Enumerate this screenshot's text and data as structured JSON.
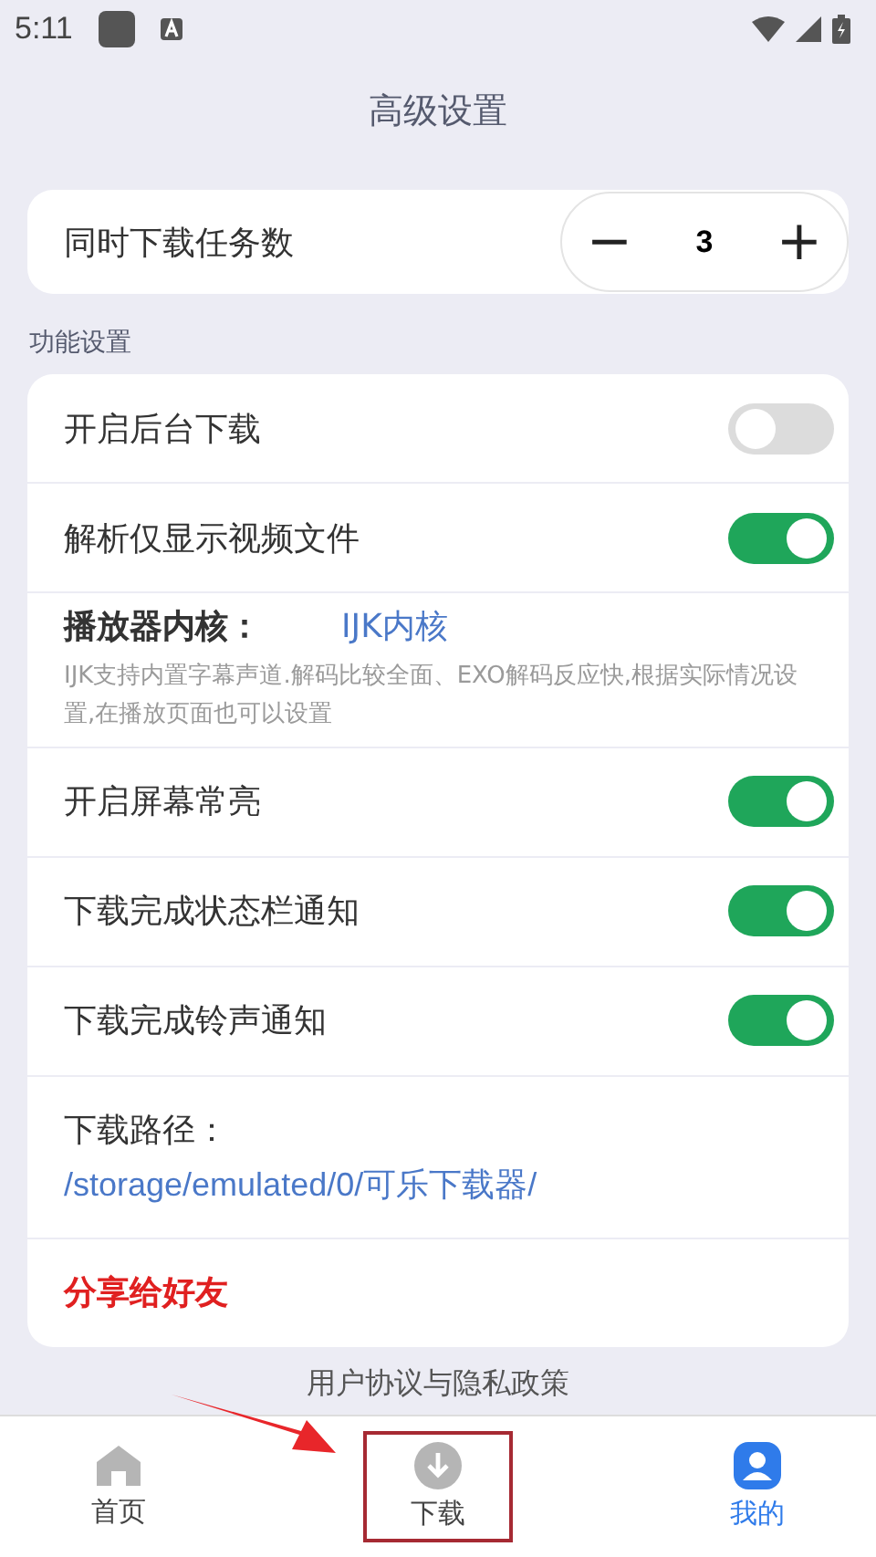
{
  "status_bar": {
    "time": "5:11"
  },
  "title": "高级设置",
  "concurrent": {
    "label": "同时下载任务数",
    "minus": "−",
    "value": "3",
    "plus": "+"
  },
  "section_title": "功能设置",
  "settings": [
    {
      "kind": "toggle",
      "label": "开启后台下载",
      "on": false
    },
    {
      "kind": "toggle",
      "label": "解析仅显示视频文件",
      "on": true
    },
    {
      "kind": "choice",
      "label": "播放器内核：",
      "value": "IJK内核",
      "description": "IJK支持内置字幕声道.解码比较全面、EXO解码反应快,根据实际情况设置,在播放页面也可以设置"
    },
    {
      "kind": "toggle",
      "label": "开启屏幕常亮",
      "on": true
    },
    {
      "kind": "toggle",
      "label": "下载完成状态栏通知",
      "on": true
    },
    {
      "kind": "toggle",
      "label": "下载完成铃声通知",
      "on": true
    },
    {
      "kind": "path",
      "label": "下载路径：",
      "value": "/storage/emulated/0/可乐下载器/"
    },
    {
      "kind": "action",
      "label": "分享给好友"
    }
  ],
  "footer_link": "用户协议与隐私政策",
  "nav": [
    {
      "kind": "home",
      "label": "首页",
      "selected": false,
      "highlighted": false
    },
    {
      "kind": "download",
      "label": "下载",
      "selected": false,
      "highlighted": true
    },
    {
      "kind": "profile",
      "label": "我的",
      "selected": true,
      "highlighted": false
    }
  ]
}
